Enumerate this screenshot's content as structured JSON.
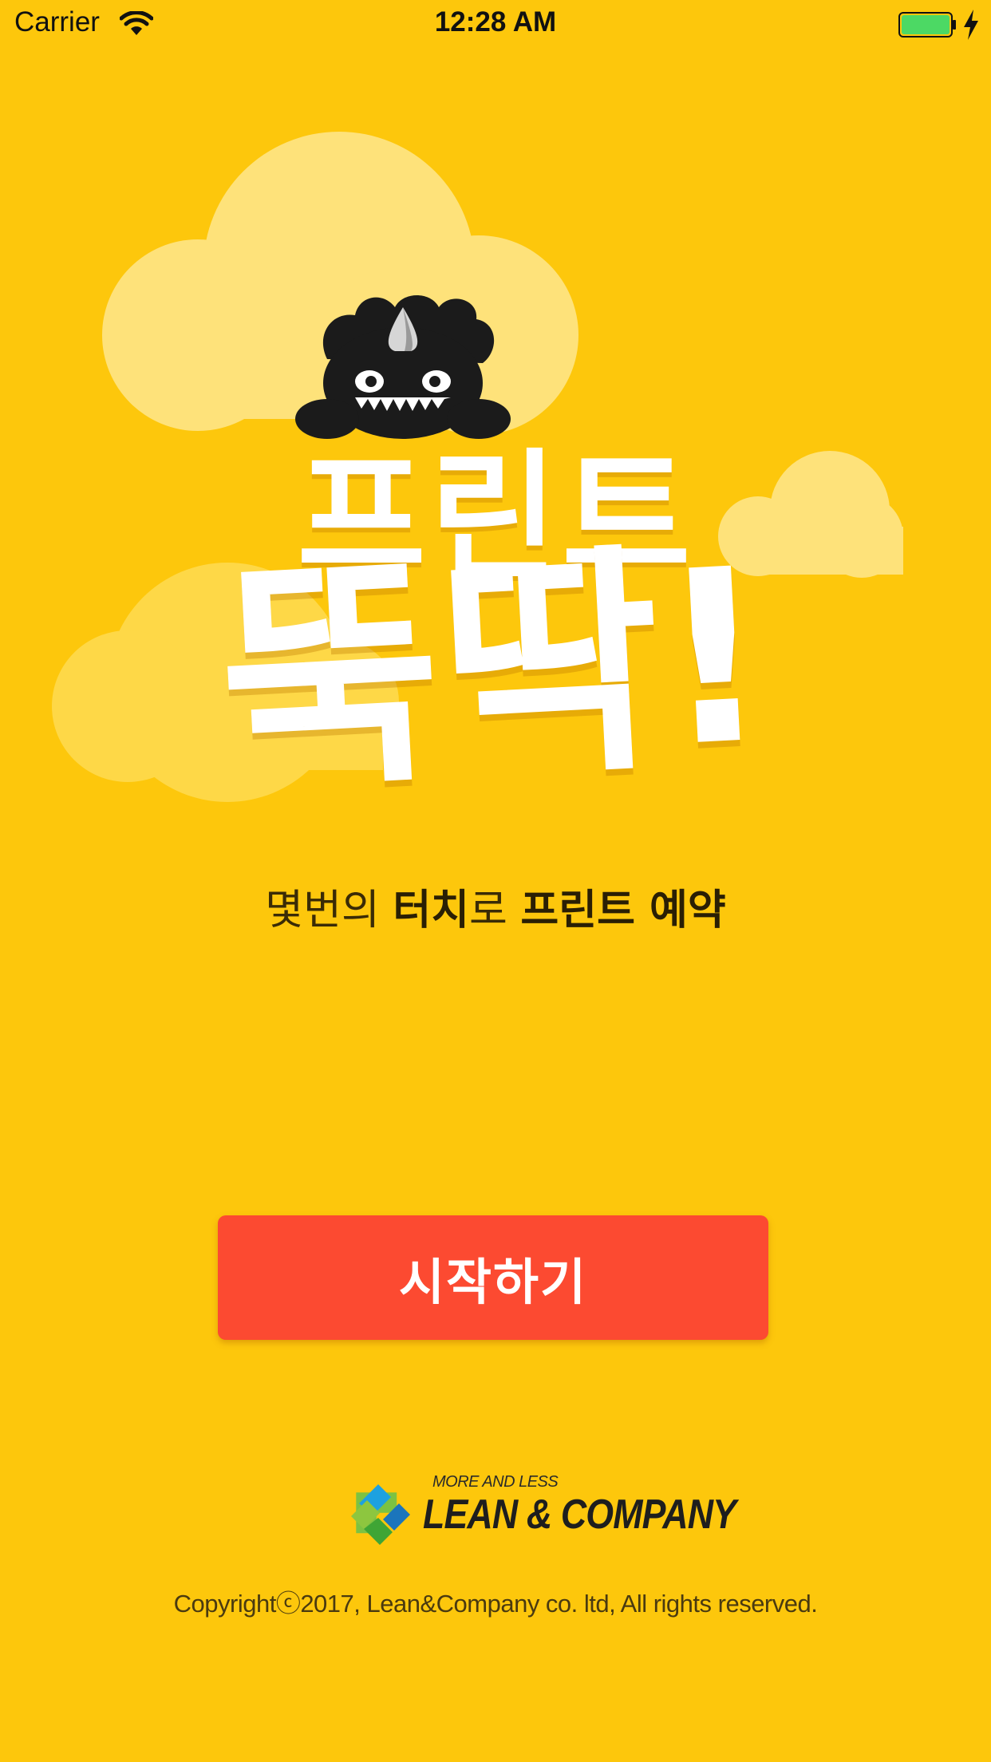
{
  "status_bar": {
    "carrier": "Carrier",
    "time": "12:28 AM",
    "battery_color": "#4CD964"
  },
  "hero": {
    "title_top": "프린트",
    "title_main": "뚝딱!",
    "mascot": "black-monster-with-horn"
  },
  "tagline": {
    "part1": "몇번의 ",
    "part2": "터치",
    "part3": "로 ",
    "part4": "프린트 예약"
  },
  "start_button": {
    "label": "시작하기",
    "color": "#FC4A31"
  },
  "company": {
    "tagline": "MORE AND LESS",
    "name": "LEAN & COMPANY"
  },
  "copyright": "Copyrightⓒ2017, Lean&Company co. ltd, All rights reserved.",
  "theme": {
    "background": "#FDC70C"
  }
}
